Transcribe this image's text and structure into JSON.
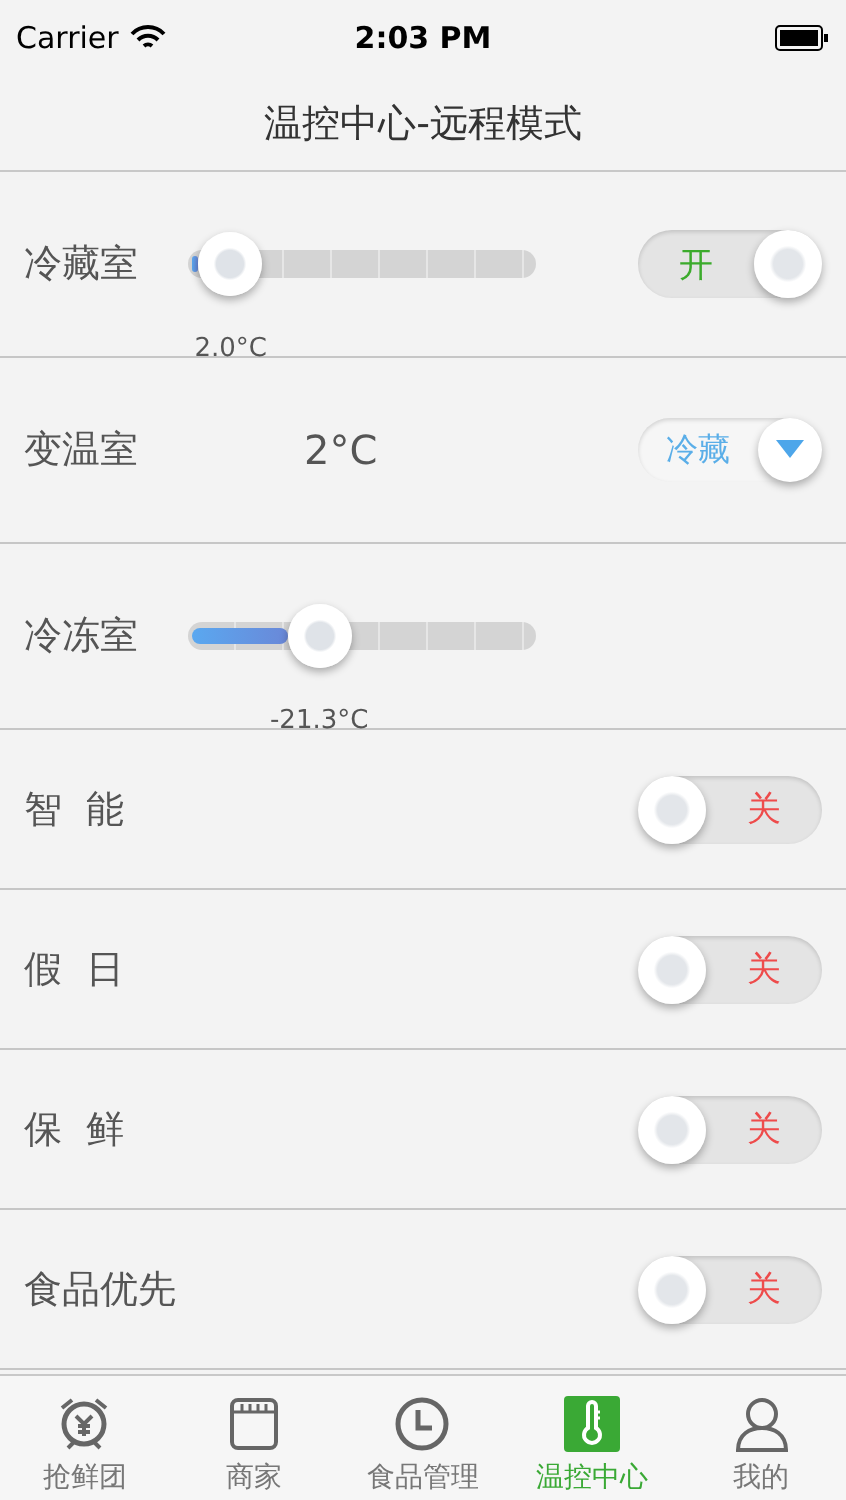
{
  "status_bar": {
    "carrier": "Carrier",
    "time": "2:03 PM"
  },
  "title": "温控中心-远程模式",
  "rows": [
    {
      "kind": "slider",
      "label": "冷藏室",
      "level": 0.02,
      "reading": "2.0°C",
      "toggle": {
        "on": true,
        "text": "开"
      }
    },
    {
      "kind": "select",
      "label": "变温室",
      "value": "2°C",
      "select": {
        "text": "冷藏"
      }
    },
    {
      "kind": "slider",
      "label": "冷冻室",
      "level": 0.28,
      "reading": "-21.3°C"
    },
    {
      "kind": "switch",
      "label": "智  能",
      "toggle": {
        "on": false,
        "text": "关"
      }
    },
    {
      "kind": "switch",
      "label": "假  日",
      "toggle": {
        "on": false,
        "text": "关"
      }
    },
    {
      "kind": "switch",
      "label": "保  鲜",
      "toggle": {
        "on": false,
        "text": "关"
      }
    },
    {
      "kind": "switch",
      "label": "食品优先",
      "toggle": {
        "on": false,
        "text": "关"
      }
    }
  ],
  "tabs": [
    {
      "label": "抢鲜团",
      "selected": false
    },
    {
      "label": "商家",
      "selected": false
    },
    {
      "label": "食品管理",
      "selected": false
    },
    {
      "label": "温控中心",
      "selected": true
    },
    {
      "label": "我的",
      "selected": false
    }
  ]
}
